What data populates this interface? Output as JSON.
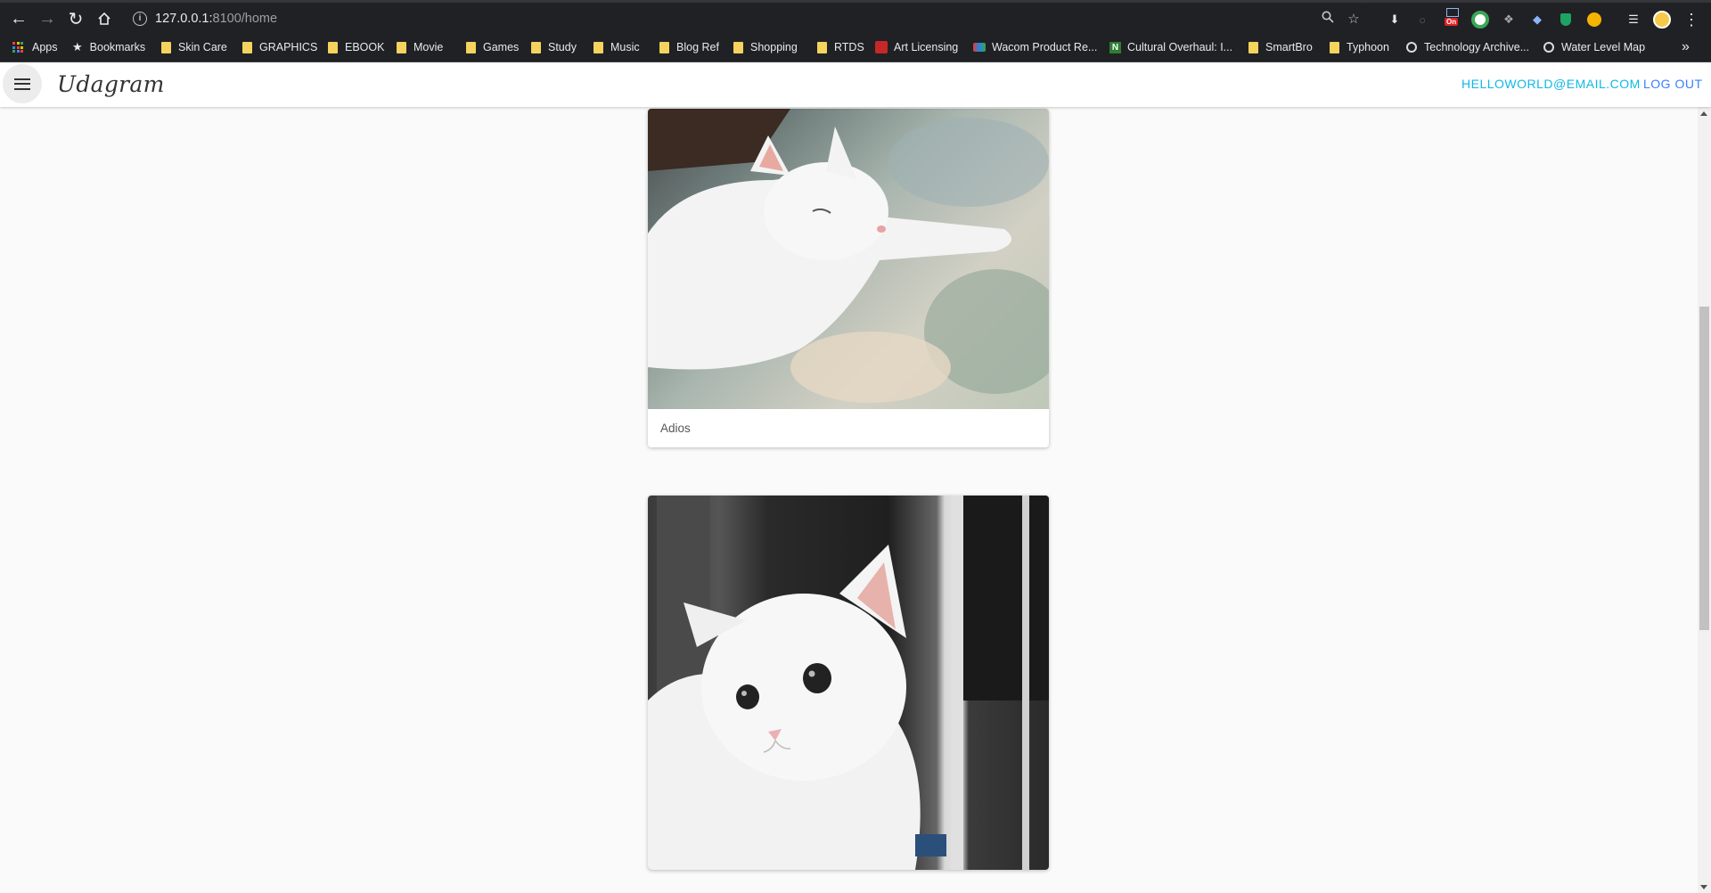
{
  "browser": {
    "url_host": "127.0.0.1:",
    "url_path": "8100/home",
    "ext_badge": "On",
    "bookmarks": [
      {
        "label": "Apps",
        "icon": "apps-grid-icon",
        "kind": "apps"
      },
      {
        "label": "Bookmarks",
        "icon": "star-icon",
        "kind": "star"
      },
      {
        "label": "Skin Care",
        "icon": "folder-icon",
        "kind": "folder"
      },
      {
        "label": "GRAPHICS",
        "icon": "folder-icon",
        "kind": "folder"
      },
      {
        "label": "EBOOK",
        "icon": "folder-icon",
        "kind": "folder"
      },
      {
        "label": "Movie",
        "icon": "folder-icon",
        "kind": "folder"
      },
      {
        "label": "Games",
        "icon": "folder-icon",
        "kind": "folder"
      },
      {
        "label": "Study",
        "icon": "folder-icon",
        "kind": "folder"
      },
      {
        "label": "Music",
        "icon": "folder-icon",
        "kind": "folder"
      },
      {
        "label": "Blog Ref",
        "icon": "folder-icon",
        "kind": "folder"
      },
      {
        "label": "Shopping",
        "icon": "folder-icon",
        "kind": "folder"
      },
      {
        "label": "RTDS",
        "icon": "folder-icon",
        "kind": "folder"
      },
      {
        "label": "Art Licensing",
        "icon": "art-licensing-icon",
        "kind": "red"
      },
      {
        "label": "Wacom Product Re...",
        "icon": "wacom-icon",
        "kind": "wacom"
      },
      {
        "label": "Cultural Overhaul: I...",
        "icon": "n-logo-icon",
        "kind": "n"
      },
      {
        "label": "SmartBro",
        "icon": "folder-icon",
        "kind": "folder"
      },
      {
        "label": "Typhoon",
        "icon": "folder-icon",
        "kind": "folder"
      },
      {
        "label": "Technology Archive...",
        "icon": "globe-icon",
        "kind": "globe"
      },
      {
        "label": "Water Level Map",
        "icon": "globe-icon",
        "kind": "globe"
      }
    ],
    "more_bookmarks": "»"
  },
  "app": {
    "title": "Udagram",
    "user_email": "HELLOWORLD@EMAIL.COM",
    "logout": "LOG OUT"
  },
  "feed": [
    {
      "caption": "Adios",
      "photo": "white cat lying on floral blanket"
    },
    {
      "caption": "",
      "photo": "white cat sitting by window"
    }
  ]
}
